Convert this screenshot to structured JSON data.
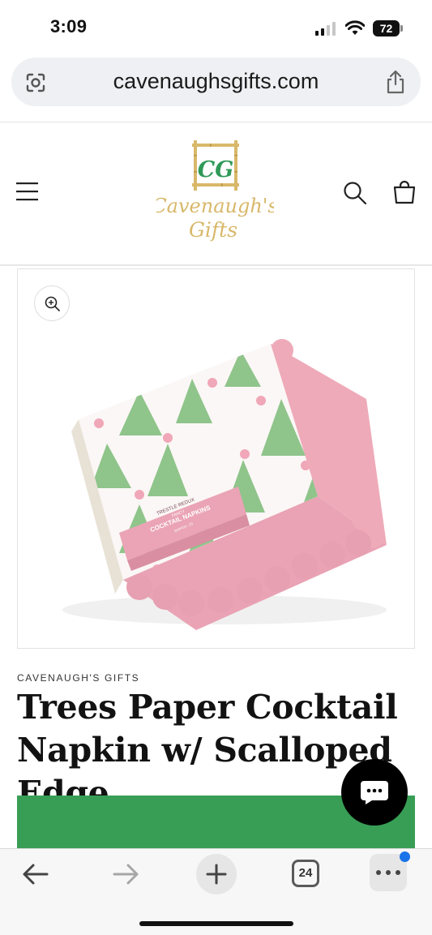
{
  "status_bar": {
    "time": "3:09",
    "battery": "72",
    "icons": [
      "signal-icon",
      "wifi-icon",
      "battery-icon"
    ]
  },
  "browser": {
    "url": "cavenaughsgifts.com",
    "tab_count": "24",
    "icons": [
      "page-tools-icon",
      "share-icon",
      "back-icon",
      "forward-icon",
      "plus-icon",
      "tabs-icon",
      "more-icon"
    ]
  },
  "header": {
    "logo_monogram": "CG",
    "logo_text": "Cavenaugh's Gifts",
    "icons": [
      "menu-icon",
      "search-icon",
      "cart-icon"
    ]
  },
  "product": {
    "vendor": "CAVENAUGH'S GIFTS",
    "title": "Trees Paper Cocktail Napkin w/ Scalloped Edge",
    "package_brand": "TRESTLE REDUX",
    "package_label_top": "FANCY",
    "package_label": "COCKTAIL NAPKINS",
    "package_quantity": "quantity: 20",
    "zoom_icon": "zoom-in-icon"
  },
  "colors": {
    "add_to_cart": "#389e55",
    "napkin_pink": "#eeaab9",
    "tree_green": "#8fc48b",
    "logo_gold": "#d8b86a",
    "logo_green": "#2f9a57"
  }
}
